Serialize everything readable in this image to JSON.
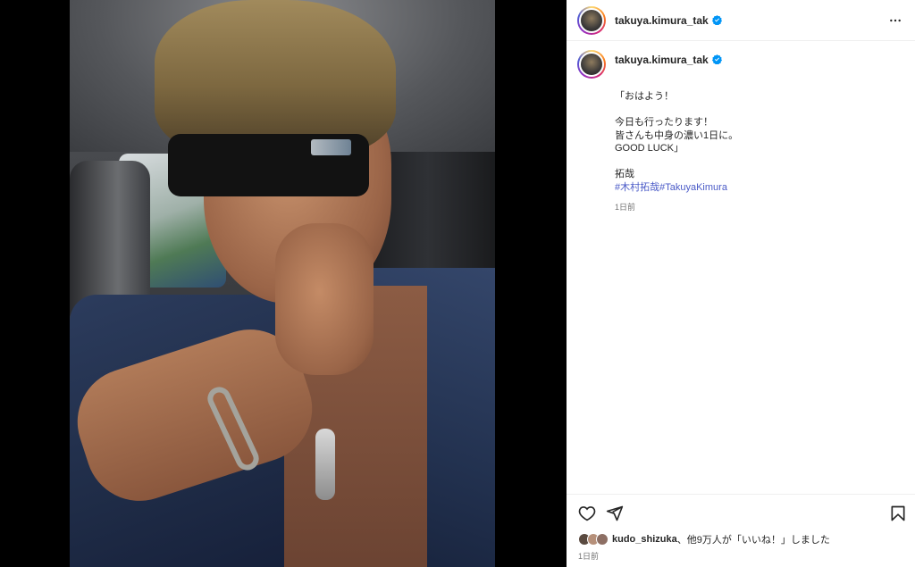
{
  "post": {
    "username": "takuya.kimura_tak",
    "caption": "「おはよう！\n\n今日も行ったります！\n皆さんも中身の濃い1日に。\nGOOD LUCK」\n\n拓哉",
    "tags": [
      "#木村拓哉",
      "#TakuyaKimura"
    ],
    "caption_time": "1日前"
  },
  "likes": {
    "first_user": "kudo_shizuka",
    "rest": "、他9万人が「いいね！」しました",
    "time": "1日前"
  },
  "colors": {
    "verified": "#0095f6",
    "link": "#4a5ac7",
    "muted": "#737373"
  },
  "icons": {
    "header_more": "more-horizontal-icon",
    "like": "heart-icon",
    "share": "send-icon",
    "save": "bookmark-icon",
    "verified": "verified-badge-icon"
  }
}
